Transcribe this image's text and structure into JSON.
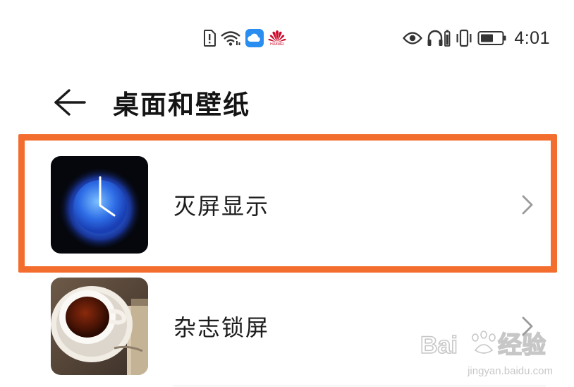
{
  "status_bar": {
    "time": "4:01",
    "brand_text": "HUAWEI",
    "left_icons": [
      "sim-alert-icon",
      "wifi-icon",
      "cloud-app-icon",
      "huawei-logo-icon"
    ],
    "right_icons": [
      "eye-comfort-icon",
      "headset-battery-icon",
      "vibrate-icon",
      "battery-icon"
    ]
  },
  "header": {
    "title": "桌面和壁纸",
    "back_icon": "arrow-left-icon"
  },
  "items": [
    {
      "label": "灭屏显示",
      "thumbnail": "clock-thumbnail",
      "chevron": "chevron-right-icon",
      "highlighted": true
    },
    {
      "label": "杂志锁屏",
      "thumbnail": "coffee-thumbnail",
      "chevron": "chevron-right-icon",
      "highlighted": false
    }
  ],
  "colors": {
    "highlight": "#f36d2e",
    "title": "#141414",
    "huawei_red": "#cf0a2c",
    "cloud_blue": "#2a8ef0"
  },
  "watermark": {
    "brand": "Bai du 经验",
    "url": "jingyan.baidu.com"
  }
}
